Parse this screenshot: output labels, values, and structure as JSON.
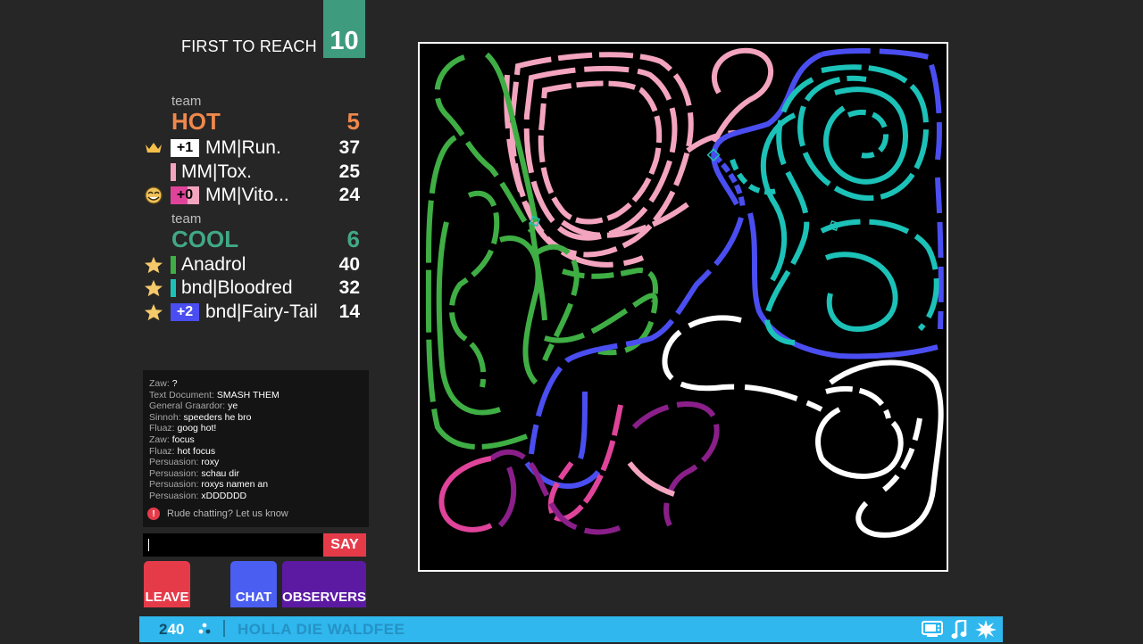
{
  "target": {
    "label": "FIRST TO REACH",
    "value": "10"
  },
  "teams": [
    {
      "caption": "team",
      "name": "HOT",
      "score": "5",
      "color": "#f0884b",
      "players": [
        {
          "icon": "crown-icon",
          "delta": "+1",
          "delta_bg": "#ffffff",
          "delta_fg": "#000000",
          "name": "MM|Run.",
          "score": "37",
          "color": "#ffffff"
        },
        {
          "icon": "",
          "delta": "",
          "name": "MM|Tox.",
          "score": "25",
          "color": "#f3a4be"
        },
        {
          "icon": "troll-face-icon",
          "delta": "+0",
          "delta_bg": "#e0449a",
          "delta_fg": "#000000",
          "name": "MM|Vito...",
          "score": "24",
          "color": "#e0449a"
        }
      ]
    },
    {
      "caption": "team",
      "name": "COOL",
      "score": "6",
      "color": "#41a885",
      "players": [
        {
          "icon": "star-icon",
          "delta": "",
          "name": "Anadrol",
          "score": "40",
          "color": "#3fae44"
        },
        {
          "icon": "star-icon",
          "delta": "",
          "name": "bnd|Bloodred",
          "score": "32",
          "color": "#1cc2b8"
        },
        {
          "icon": "star-icon",
          "delta": "+2",
          "delta_bg": "#4a4ef0",
          "delta_fg": "#ffffff",
          "name": "bnd|Fairy-Tail",
          "score": "14",
          "color": "#4a4ef0"
        }
      ]
    }
  ],
  "chat": {
    "messages": [
      {
        "who": "Zaw:",
        "msg": "?"
      },
      {
        "who": "Text Document:",
        "msg": "SMASH THEM"
      },
      {
        "who": "General Graardor:",
        "msg": "ye"
      },
      {
        "who": "Sinnoh:",
        "msg": "speeders he bro"
      },
      {
        "who": "Fluaz:",
        "msg": "goog hot!"
      },
      {
        "who": "Zaw:",
        "msg": "focus"
      },
      {
        "who": "Fluaz:",
        "msg": "hot focus"
      },
      {
        "who": "Persuasion:",
        "msg": "roxy"
      },
      {
        "who": "Persuasion:",
        "msg": "schau dir"
      },
      {
        "who": "Persuasion:",
        "msg": "roxys namen an"
      },
      {
        "who": "Persuasion:",
        "msg": "xDDDDDD"
      }
    ],
    "rude_notice": "Rude chatting? Let us know",
    "input_value": "",
    "say_label": "SAY"
  },
  "buttons": {
    "leave": "LEAVE",
    "chat": "CHAT",
    "observers": "OBSERVERS"
  },
  "bottombar": {
    "online_a": "2",
    "online_b": "40",
    "motd": "HOLLA DIE WALDFEE"
  },
  "colors": {
    "hot": "#f0884b",
    "cool": "#41a885",
    "leave": "#e53b49",
    "chat": "#4a5ef1",
    "observers": "#5c1aa3",
    "bottombar": "#2fb7ee",
    "target": "#3e9b7e"
  }
}
